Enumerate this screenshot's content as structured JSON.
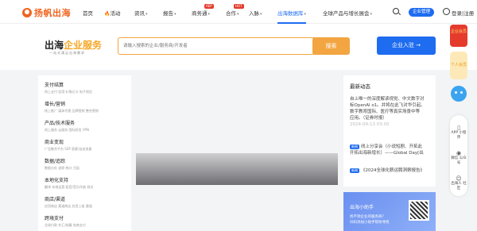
{
  "header": {
    "logo_text": "扬帆出海",
    "nav": [
      {
        "label": "首页"
      },
      {
        "label": "活动"
      },
      {
        "label": "资讯"
      },
      {
        "label": "报告"
      },
      {
        "label": "商务通",
        "badge": "AEP"
      },
      {
        "label": "合作",
        "badge": "HOT"
      },
      {
        "label": "入脉"
      },
      {
        "label": "出海数据库"
      },
      {
        "label": "全球产品与增长展会"
      }
    ],
    "manage_button": "企业管理",
    "login_text": "登录|注册"
  },
  "brand": {
    "title_main": "出海",
    "title_accent": "企业服务",
    "subtitle": "一站式满足出海需求",
    "search_placeholder": "请输入搜索的企业/服务商/开发者",
    "search_button": "搜索",
    "entry_button": "企业入驻 →"
  },
  "categories": [
    {
      "title": "支付结算",
      "sub": "线上支付  信用卡/借记卡  电子钱包"
    },
    {
      "title": "增长/营销",
      "sub": "线上推广  媒体代理  品牌营销  整合营销"
    },
    {
      "title": "产品/技术服务",
      "sub": "线上服务  云服务  国际短信  VPN"
    },
    {
      "title": "商业变现",
      "sub": "广告聚合平台  SSP  直客/自由流量"
    },
    {
      "title": "数据/追踪",
      "sub": "数据分析  追踪  统计  归因"
    },
    {
      "title": "本地化支持",
      "sub": "翻译  本地运营  配音/音乐作曲  测试"
    },
    {
      "title": "商店/渠道",
      "sub": "应用商店  渠道商店  应用上架  渠道"
    },
    {
      "title": "跨境支付",
      "sub": "全球付款  外汇/结算  电商支付"
    }
  ],
  "news": {
    "title": "最新动态",
    "items": [
      {
        "text": "自上唯一的深度解读视觉、中文数字对"
      },
      {
        "text": "标OpenAI o1。并将在此飞对华引起。"
      },
      {
        "text": "数字教育国际、医疗等真实场景中等"
      },
      {
        "text": "应用。（证券时报）"
      },
      {
        "date": "2024-09-13 03:00"
      },
      {
        "tag": "新闻",
        "text": "线上分享会（小说短剧、开拓此"
      },
      {
        "text": "开拓出海新增长）——Global Day[出"
      },
      {
        "tag": "新闻",
        "text": "《2024全球化薪运聘洞察报告》"
      }
    ]
  },
  "helper": {
    "title": "出海小助手",
    "line1": "找不到企业的服务商?",
    "line2": "扫码添加小助手帮你寻找"
  },
  "sidebar": {
    "vip": "企业会员",
    "personal": "个人会员",
    "items": [
      {
        "icon": "phone-icon",
        "glyph": "▯",
        "label": "APP 小程序"
      },
      {
        "icon": "wechat-icon",
        "glyph": "◉",
        "label": "微信 公众号"
      },
      {
        "icon": "person-icon",
        "glyph": "☺",
        "label": "出海人 社区"
      }
    ]
  },
  "colors": {
    "brand_orange": "#f0641e",
    "primary_blue": "#1e6cf0",
    "search_orange": "#f2a541",
    "vip_red": "#e53b2c"
  }
}
